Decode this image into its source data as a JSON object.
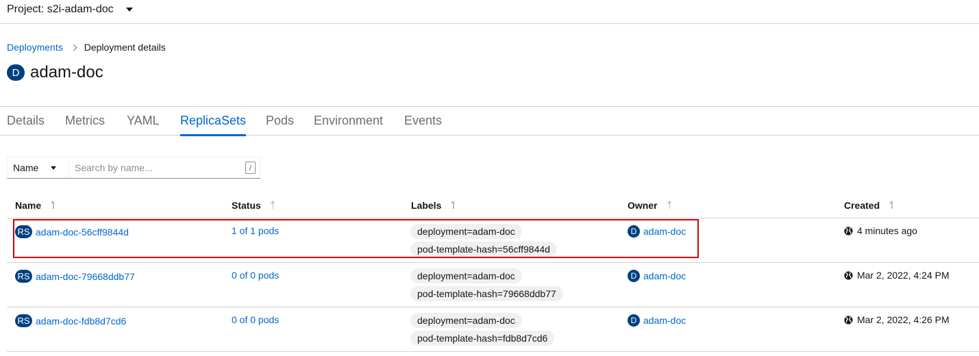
{
  "project": {
    "label": "Project: s2i-adam-doc"
  },
  "breadcrumb": {
    "parent": "Deployments",
    "current": "Deployment details"
  },
  "heading": {
    "badge": "D",
    "title": "adam-doc"
  },
  "tabs": [
    {
      "label": "Details"
    },
    {
      "label": "Metrics"
    },
    {
      "label": "YAML"
    },
    {
      "label": "ReplicaSets"
    },
    {
      "label": "Pods"
    },
    {
      "label": "Environment"
    },
    {
      "label": "Events"
    }
  ],
  "active_tab": "ReplicaSets",
  "filter": {
    "type": "Name",
    "placeholder": "Search by name...",
    "shortcut": "/"
  },
  "table": {
    "headers": {
      "name": "Name",
      "status": "Status",
      "labels": "Labels",
      "owner": "Owner",
      "created": "Created"
    },
    "rows": [
      {
        "badge": "RS",
        "name": "adam-doc-56cff9844d",
        "status": "1 of 1 pods",
        "labels": [
          "deployment=adam-doc",
          "pod-template-hash=56cff9844d"
        ],
        "owner_badge": "D",
        "owner": "adam-doc",
        "created": "4 minutes ago"
      },
      {
        "badge": "RS",
        "name": "adam-doc-79668ddb77",
        "status": "0 of 0 pods",
        "labels": [
          "deployment=adam-doc",
          "pod-template-hash=79668ddb77"
        ],
        "owner_badge": "D",
        "owner": "adam-doc",
        "created": "Mar 2, 2022, 4:24 PM"
      },
      {
        "badge": "RS",
        "name": "adam-doc-fdb8d7cd6",
        "status": "0 of 0 pods",
        "labels": [
          "deployment=adam-doc",
          "pod-template-hash=fdb8d7cd6"
        ],
        "owner_badge": "D",
        "owner": "adam-doc",
        "created": "Mar 2, 2022, 4:26 PM"
      }
    ]
  },
  "colors": {
    "link": "#0066cc",
    "badge": "#004080",
    "highlight": "#d00000"
  }
}
